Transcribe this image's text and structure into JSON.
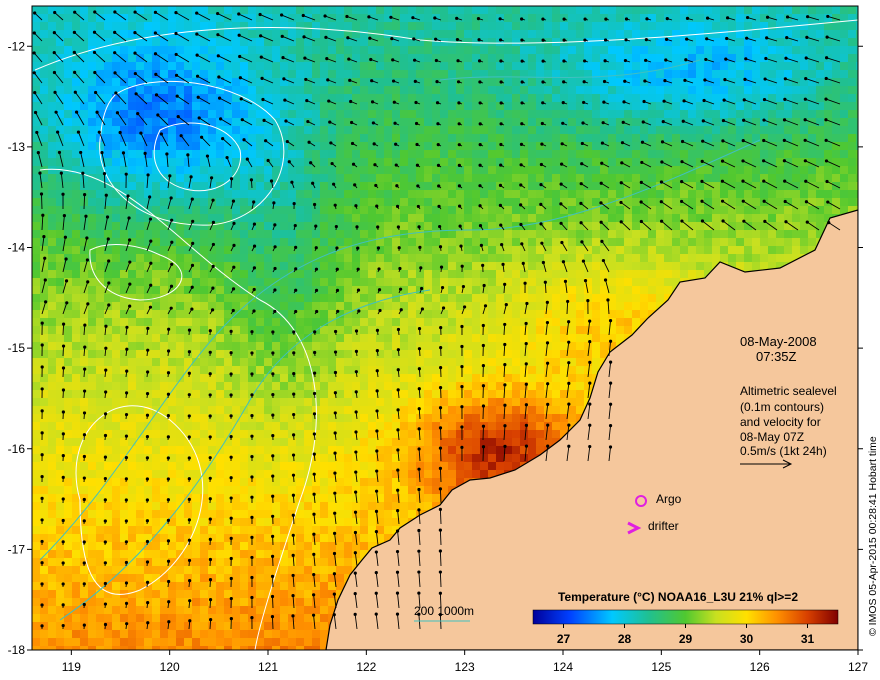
{
  "map": {
    "lon_range": [
      118.6,
      127.0
    ],
    "lat_range": [
      -18.0,
      -11.6
    ],
    "x_ticks": [
      "119",
      "120",
      "121",
      "122",
      "123",
      "124",
      "125",
      "126",
      "127"
    ],
    "y_ticks": [
      "-12",
      "-13",
      "-14",
      "-15",
      "-16",
      "-17",
      "-18"
    ],
    "land_color": "#f5c79c",
    "coast_color": "#000000"
  },
  "annotations": {
    "date": "08-May-2008",
    "time": "07:35Z",
    "altimetry_lines": [
      "Altimetric sealevel",
      "(0.1m contours)",
      "and velocity for",
      "08-May 07Z",
      "0.5m/s (1kt 24h)"
    ],
    "argo_label": "Argo",
    "drifter_label": "drifter",
    "marker_color": "#e020e0"
  },
  "legend": {
    "title": "Temperature (°C) NOAA16_L3U 21% ql>=2",
    "ticks": [
      "27",
      "28",
      "29",
      "30",
      "31"
    ],
    "min": 26.5,
    "max": 31.5
  },
  "depth_legend": {
    "text": "200  1000m",
    "color": "#40c0c0"
  },
  "credit": "© IMOS 05-Apr-2015 00:28:41 Hobart time"
}
